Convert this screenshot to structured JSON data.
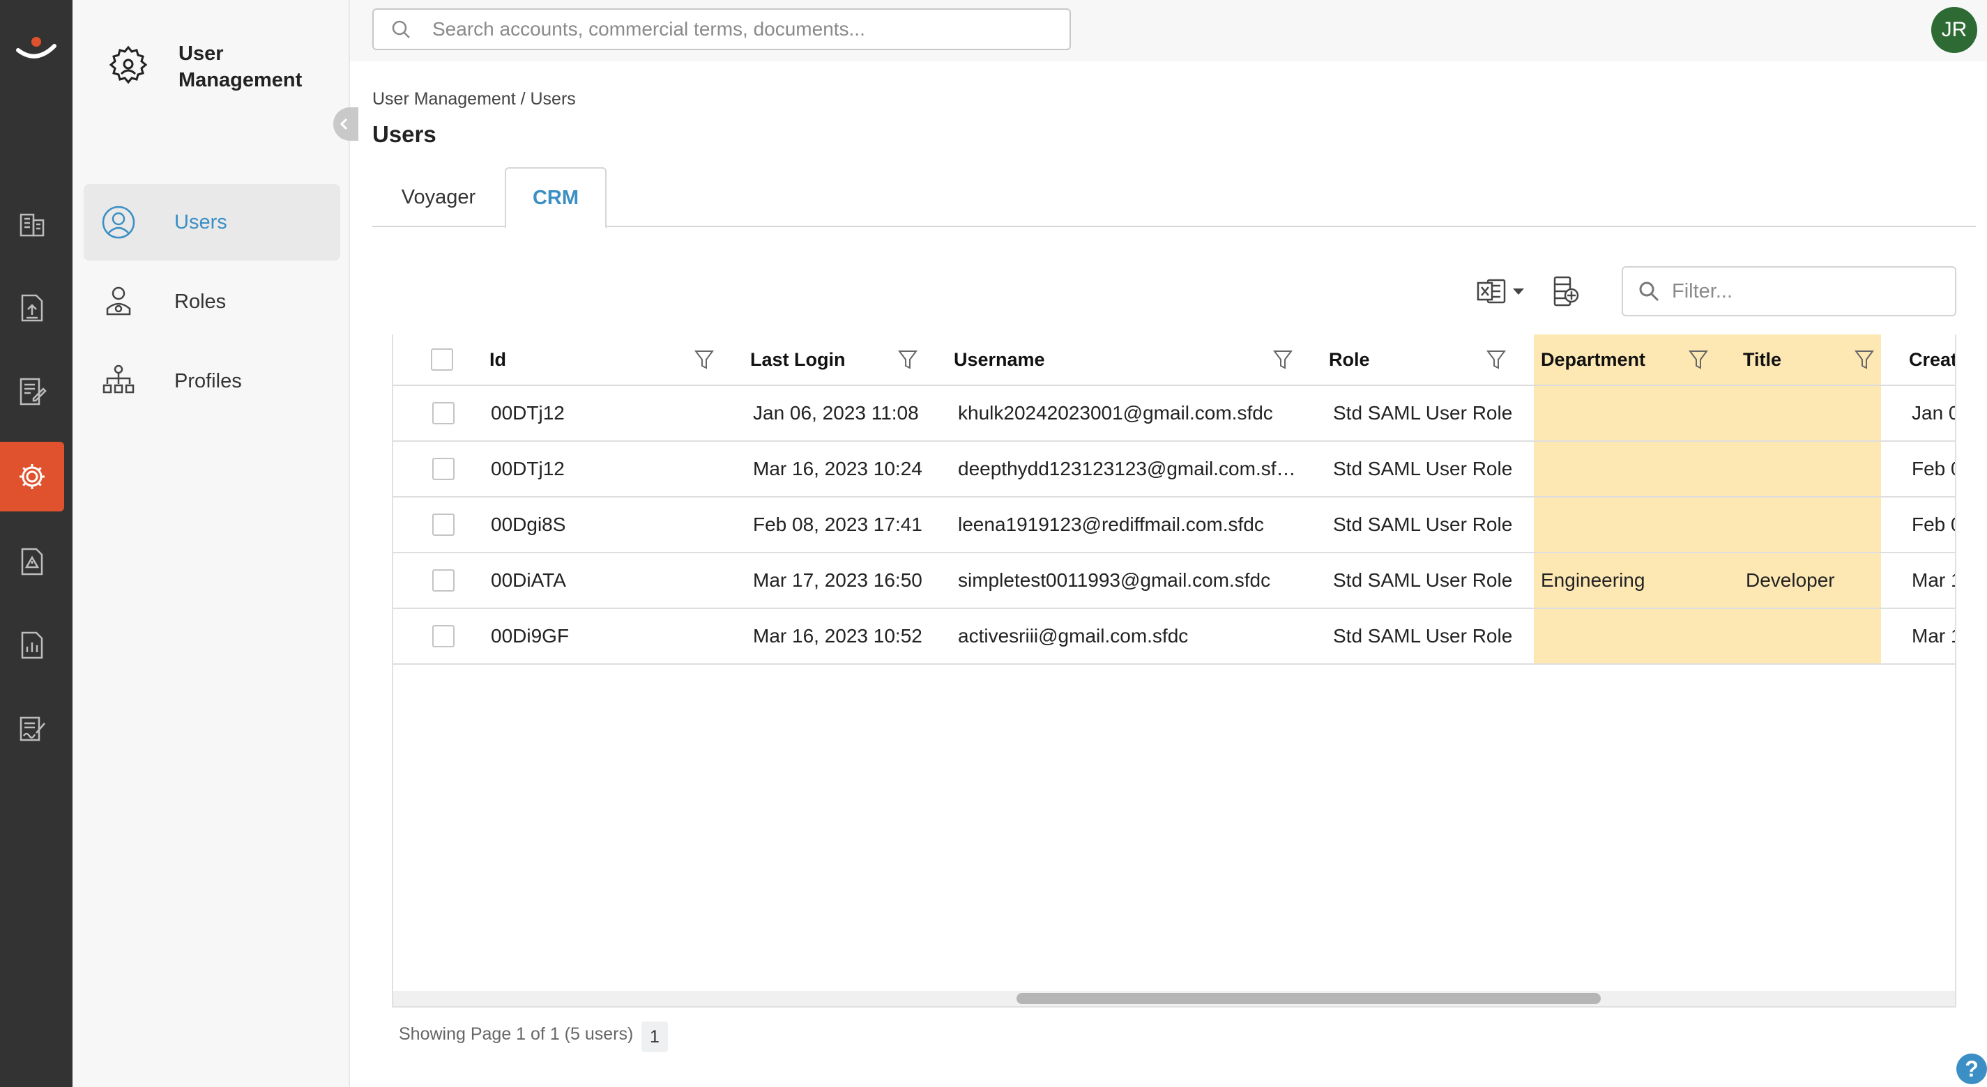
{
  "rail": {
    "items": [
      {
        "icon": "buildings-icon"
      },
      {
        "icon": "document-upload-icon"
      },
      {
        "icon": "document-edit-icon"
      },
      {
        "icon": "settings-gear-icon",
        "active": true
      },
      {
        "icon": "alert-document-icon"
      },
      {
        "icon": "report-document-icon"
      },
      {
        "icon": "contract-sign-icon"
      }
    ]
  },
  "sidebar": {
    "title": "User Management",
    "items": [
      {
        "label": "Users",
        "icon": "user-circle-icon",
        "active": true
      },
      {
        "label": "Roles",
        "icon": "user-role-icon"
      },
      {
        "label": "Profiles",
        "icon": "org-chart-icon"
      }
    ]
  },
  "topbar": {
    "search_placeholder": "Search accounts, commercial terms, documents...",
    "avatar_initials": "JR"
  },
  "breadcrumb": "User Management / Users",
  "page_title": "Users",
  "tabs": [
    {
      "label": "Voyager"
    },
    {
      "label": "CRM",
      "active": true
    }
  ],
  "toolbar": {
    "filter_placeholder": "Filter..."
  },
  "table": {
    "columns": [
      "Id",
      "Last Login",
      "Username",
      "Role",
      "Department",
      "Title",
      "Creat"
    ],
    "highlighted_columns": [
      "Department",
      "Title"
    ],
    "highlight_color": "#fde8b4",
    "rows": [
      {
        "id": "00DTj12",
        "last_login": "Jan 06, 2023 11:08",
        "username": "khulk20242023001@gmail.com.sfdc",
        "role": "Std SAML User Role",
        "department": "",
        "title": "",
        "created": "Jan 0"
      },
      {
        "id": "00DTj12",
        "last_login": "Mar 16, 2023 10:24",
        "username": "deepthydd123123123@gmail.com.sf…",
        "role": "Std SAML User Role",
        "department": "",
        "title": "",
        "created": "Feb 0"
      },
      {
        "id": "00Dgi8S",
        "last_login": "Feb 08, 2023 17:41",
        "username": "leena1919123@rediffmail.com.sfdc",
        "role": "Std SAML User Role",
        "department": "",
        "title": "",
        "created": "Feb 0"
      },
      {
        "id": "00DiATA",
        "last_login": "Mar 17, 2023 16:50",
        "username": "simpletest0011993@gmail.com.sfdc",
        "role": "Std SAML User Role",
        "department": "Engineering",
        "title": "Developer",
        "created": "Mar 1"
      },
      {
        "id": "00Di9GF",
        "last_login": "Mar 16, 2023 10:52",
        "username": "activesriii@gmail.com.sfdc",
        "role": "Std SAML User Role",
        "department": "",
        "title": "",
        "created": "Mar 1"
      }
    ]
  },
  "footer": {
    "status": "Showing Page 1 of 1 (5 users)",
    "current_page": "1"
  },
  "colors": {
    "accent": "#3b8fc4",
    "active_rail": "#e0512d",
    "rail_bg": "#333333",
    "avatar_bg": "#2d6a34"
  }
}
